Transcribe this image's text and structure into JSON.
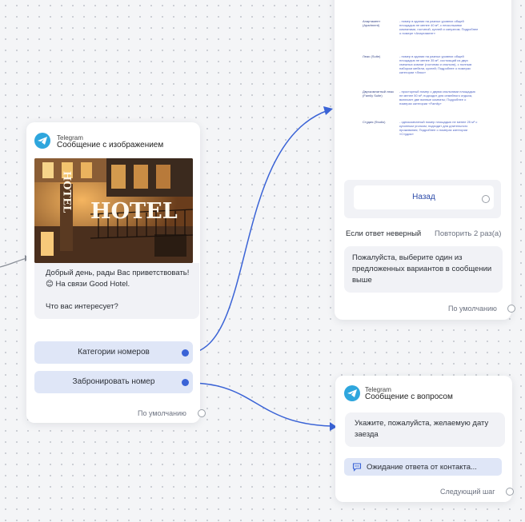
{
  "colors": {
    "accent": "#3a63d6",
    "telegram": "#2ea6dd",
    "button_bg": "#dfe6f7",
    "bubble_bg": "#f1f2f6"
  },
  "image_card": {
    "channel": "Telegram",
    "title": "Сообщение с изображением",
    "image_sign": "HOTEL",
    "image_sign_vertical": "HOTEL",
    "message": "Добрый день, рады Вас приветствовать! 😊 На связи Good Hotel.\n\nЧто вас интересует?",
    "buttons": [
      {
        "label": "Категории номеров"
      },
      {
        "label": "Забронировать номер"
      }
    ],
    "default_label": "По умолчанию"
  },
  "list_card": {
    "rows": [
      {
        "name": "Апартамент (Apartment)",
        "text": "- номер в здании на разных уровнях общей площадью не менее 40 м², с несколькими комнатами, гостиной, кухней и санузлом; Подробнее о номере «Апартамент»"
      },
      {
        "name": "Люкс (Suite)",
        "text": "- номер в здании на разных уровнях общей площадью не менее 35 м², состоящий из двух смежных комнат (гостиная и спальня), с полным набором мебели, кухней; Подробнее о номерах категории «Люкс»"
      },
      {
        "name": "Двухкомнатный люкс (Family Suite)",
        "text": "- просторный номер с двумя спальнями площадью не менее 50 м²; подходит для семейного отдыха, включает две ванные комнаты; Подробнее о номерах категории «Family»"
      },
      {
        "name": "Студия (Studio)",
        "text": "- однокомнатный номер площадью не менее 25 м² с кухонным уголком; подходит для длительного проживания; Подробнее о номерах категории «Студия»"
      }
    ],
    "back_label": "Назад",
    "wrong_answer_label": "Если ответ неверный",
    "retry_label": "Повторить 2 раз(а)",
    "error_message": "Пожалуйста, выберите один из предложенных вариантов в сообщении выше",
    "default_label": "По умолчанию"
  },
  "question_card": {
    "channel": "Telegram",
    "title": "Сообщение с вопросом",
    "message": "Укажите, пожалуйста, желаемую дату заезда",
    "waiting_label": "Ожидание ответа от контакта...",
    "next_label": "Следующий шаг"
  }
}
